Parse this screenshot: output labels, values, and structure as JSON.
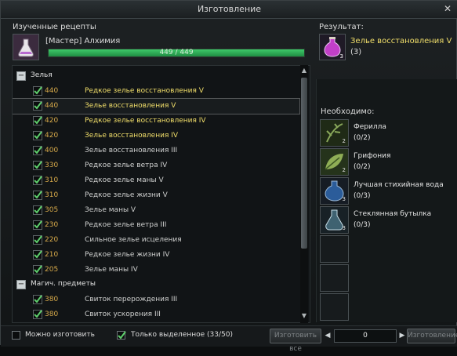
{
  "window": {
    "title": "Изготовление"
  },
  "known_recipes": {
    "label": "Изученные рецепты",
    "profession": "[Мастер] Алхимия",
    "progress_text": "449 / 449",
    "progress": 1.0
  },
  "result": {
    "label": "Результат:",
    "item_name": "Зелье восстановления V",
    "count": "(3)",
    "stack": "3"
  },
  "categories": [
    {
      "label": "Зелья"
    },
    {
      "label": "Магич. предметы"
    }
  ],
  "recipes": [
    {
      "level": "440",
      "name": "Редкое зелье восстановления V",
      "color": "gold"
    },
    {
      "level": "440",
      "name": "Зелье восстановления V",
      "color": "gold"
    },
    {
      "level": "420",
      "name": "Редкое зелье восстановления IV",
      "color": "gold"
    },
    {
      "level": "420",
      "name": "Зелье восстановления IV",
      "color": "gold"
    },
    {
      "level": "400",
      "name": "Зелье восстановления III",
      "color": "white"
    },
    {
      "level": "330",
      "name": "Редкое зелье ветра IV",
      "color": "white"
    },
    {
      "level": "310",
      "name": "Редкое зелье маны V",
      "color": "white"
    },
    {
      "level": "310",
      "name": "Редкое зелье жизни V",
      "color": "white"
    },
    {
      "level": "305",
      "name": "Зелье маны V",
      "color": "white"
    },
    {
      "level": "230",
      "name": "Редкое зелье ветра III",
      "color": "white"
    },
    {
      "level": "220",
      "name": "Сильное зелье исцеления",
      "color": "white"
    },
    {
      "level": "210",
      "name": "Редкое зелье жизни IV",
      "color": "white"
    },
    {
      "level": "205",
      "name": "Зелье маны IV",
      "color": "white"
    }
  ],
  "recipes2": [
    {
      "level": "380",
      "name": "Свиток перерождения III",
      "color": "white"
    },
    {
      "level": "380",
      "name": "Свиток ускорения III",
      "color": "white"
    }
  ],
  "required": {
    "label": "Необходимо:",
    "items": [
      {
        "name": "Ферилла",
        "count": "(0/2)",
        "stack": "2"
      },
      {
        "name": "Грифония",
        "count": "(0/2)",
        "stack": "2"
      },
      {
        "name": "Лучшая стихийная вода",
        "count": "(0/3)",
        "stack": "3"
      },
      {
        "name": "Стеклянная бутылка",
        "count": "(0/3)",
        "stack": "3"
      }
    ]
  },
  "bottom": {
    "can_make_label": "Можно изготовить",
    "only_selected_label": "Только выделенное (33/50)",
    "make_all_button": "Изготовить все",
    "quantity": "0",
    "make_button": "Изготовление"
  },
  "colors": {
    "gold_text": "#f2df6a",
    "level_text": "#d6a94a",
    "progress": "#3fc86a"
  }
}
